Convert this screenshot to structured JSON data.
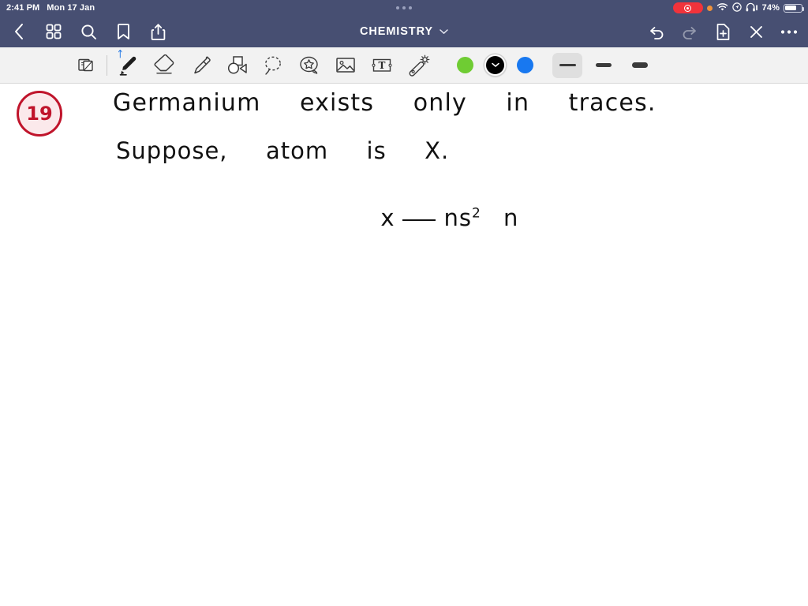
{
  "status_bar": {
    "time": "2:41 PM",
    "date": "Mon 17 Jan",
    "battery_percent": "74%",
    "icons": {
      "multitask": "multitask-dots",
      "recording": "screen-record-indicator",
      "privacy": "orange-privacy-dot",
      "wifi": "wifi-icon",
      "location": "location-icon",
      "headphones": "headphones-icon",
      "battery": "battery-icon"
    }
  },
  "nav_bar": {
    "title": "CHEMISTRY",
    "title_chevron": "chevron-down-icon",
    "left_items": [
      {
        "name": "back-button",
        "icon": "chevron-left-icon"
      },
      {
        "name": "thumbnails-button",
        "icon": "grid-icon"
      },
      {
        "name": "search-button",
        "icon": "search-icon"
      },
      {
        "name": "bookmark-button",
        "icon": "bookmark-icon"
      },
      {
        "name": "share-button",
        "icon": "share-icon"
      }
    ],
    "right_items": [
      {
        "name": "undo-button",
        "icon": "undo-icon",
        "enabled": true
      },
      {
        "name": "redo-button",
        "icon": "redo-icon",
        "enabled": false
      },
      {
        "name": "add-page-button",
        "icon": "document-plus-icon",
        "enabled": true
      },
      {
        "name": "close-button",
        "icon": "close-x-icon",
        "enabled": true
      },
      {
        "name": "more-button",
        "icon": "ellipsis-icon",
        "enabled": true
      }
    ]
  },
  "toolbar": {
    "tools": [
      {
        "name": "page-layout-tool",
        "icon": "page-stack-icon",
        "selected": false
      },
      {
        "name": "pen-tool",
        "icon": "pen-icon",
        "selected": true,
        "badge": "bluetooth-icon"
      },
      {
        "name": "eraser-tool",
        "icon": "eraser-icon",
        "selected": false
      },
      {
        "name": "highlighter-tool",
        "icon": "highlighter-icon",
        "selected": false
      },
      {
        "name": "shapes-tool",
        "icon": "shapes-icon",
        "selected": false
      },
      {
        "name": "lasso-tool",
        "icon": "lasso-icon",
        "selected": false
      },
      {
        "name": "sticker-tool",
        "icon": "sticker-star-icon",
        "selected": false
      },
      {
        "name": "image-tool",
        "icon": "image-icon",
        "selected": false
      },
      {
        "name": "text-tool",
        "icon": "text-box-icon",
        "selected": false
      },
      {
        "name": "magic-tool",
        "icon": "magic-wand-icon",
        "selected": false
      }
    ],
    "colors": [
      {
        "name": "color-swatch-green",
        "hex": "#6FCC33",
        "selected": false
      },
      {
        "name": "color-swatch-black",
        "hex": "#000000",
        "selected": true
      },
      {
        "name": "color-swatch-blue",
        "hex": "#1878F0",
        "selected": false
      }
    ],
    "stroke_widths": [
      {
        "name": "stroke-width-thin",
        "selected": true
      },
      {
        "name": "stroke-width-medium",
        "selected": false
      },
      {
        "name": "stroke-width-thick",
        "selected": false
      }
    ]
  },
  "canvas": {
    "question_number": "19",
    "handwriting": {
      "line1": "Germanium  exists  only  in  traces.",
      "line2": "Suppose,  atom  is  X.",
      "line3_lead": "x",
      "line3_base": "ns",
      "line3_sup": "2",
      "line3_tail": "n"
    }
  }
}
